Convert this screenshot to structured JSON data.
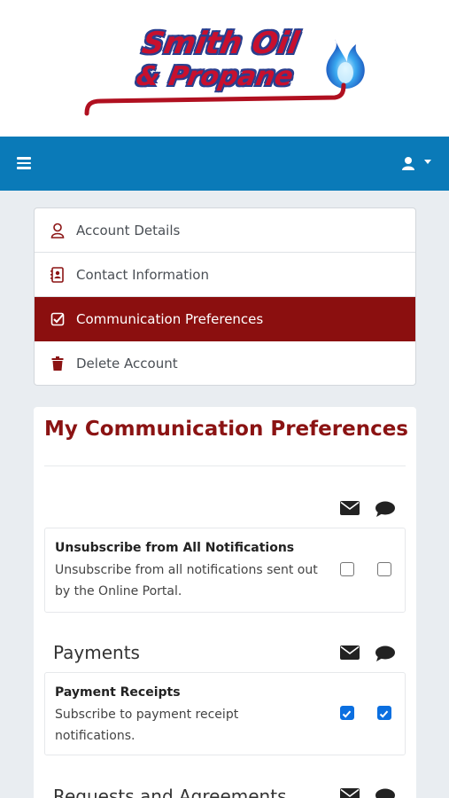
{
  "brand": {
    "logo_line1": "Smith Oil",
    "logo_line2": "& Propane"
  },
  "navbar": {
    "color": "#0a7ab8",
    "menu_icon": "hamburger-icon",
    "user_icon": "user-icon"
  },
  "account_menu": {
    "items": [
      {
        "label": "Account Details",
        "icon": "user-outline-icon",
        "active": false
      },
      {
        "label": "Contact Information",
        "icon": "address-book-icon",
        "active": false
      },
      {
        "label": "Communication Preferences",
        "icon": "check-square-icon",
        "active": true
      },
      {
        "label": "Delete Account",
        "icon": "trash-icon",
        "active": false
      }
    ],
    "active_color": "#8b0f0f"
  },
  "preferences": {
    "title": "My Communication Preferences",
    "channel_icons": [
      "envelope-icon",
      "comment-icon"
    ],
    "unsubscribe": {
      "name": "Unsubscribe from All Notifications",
      "description": "Unsubscribe from all notifications sent out by the Online Portal.",
      "email": false,
      "sms": false
    },
    "sections": [
      {
        "heading": "Payments",
        "items": [
          {
            "name": "Payment Receipts",
            "description": "Subscribe to payment receipt notifications.",
            "email": true,
            "sms": true
          }
        ]
      },
      {
        "heading": "Requests and Agreements",
        "items": []
      }
    ]
  }
}
